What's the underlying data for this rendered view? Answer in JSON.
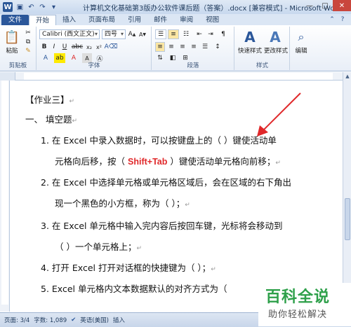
{
  "window": {
    "app_icon": "W",
    "title": "计算机文化基础第3版办公软件课后题（答案）.docx [兼容模式] - Microsoft Word",
    "qat_icons": [
      "save-icon",
      "undo-icon",
      "redo-icon",
      "customize-icon"
    ]
  },
  "tabs": [
    "文件",
    "开始",
    "插入",
    "页面布局",
    "引用",
    "邮件",
    "审阅",
    "视图"
  ],
  "ribbon": {
    "clipboard": {
      "paste": "粘贴",
      "label": "剪贴板"
    },
    "font": {
      "name": "Calibri (西文正文)",
      "size": "四号",
      "label": "字体"
    },
    "paragraph": {
      "label": "段落"
    },
    "styles": {
      "quick": "快速样式",
      "change": "更改样式",
      "label": "样式"
    },
    "editing": {
      "label": "编辑"
    }
  },
  "document": {
    "lines": [
      "【作业三】",
      "一、   填空题",
      "1.  在 Excel 中录入数据时，可以按键盘上的（        ）键使活动单",
      "元格向后移，按（",
      "Shift+Tab",
      "）键使活动单元格向前移；",
      "2.  在 Excel 中选择单元格或单元格区域后，会在区域的右下角出",
      "现一个黑色的小方框，称为（        ）；",
      "3.  在 Excel 单元格中输入完内容后按回车键，光标将会移动到",
      "（          ）一个单元格上；",
      "4.  打开 Excel 打开对话框的快捷键为（                 ）；",
      "5.  Excel 单元格内文本数据默认的对齐方式为（"
    ]
  },
  "status": {
    "page": "页面: 3/4",
    "words": "字数: 1,089",
    "language": "英语(美国)",
    "mode": "插入"
  },
  "watermark": {
    "main": "百科全说",
    "sub": "助你轻松解决"
  },
  "colors": {
    "accent": "#2b579a",
    "annotation": "#e0282a",
    "watermark": "#2ea04a"
  }
}
